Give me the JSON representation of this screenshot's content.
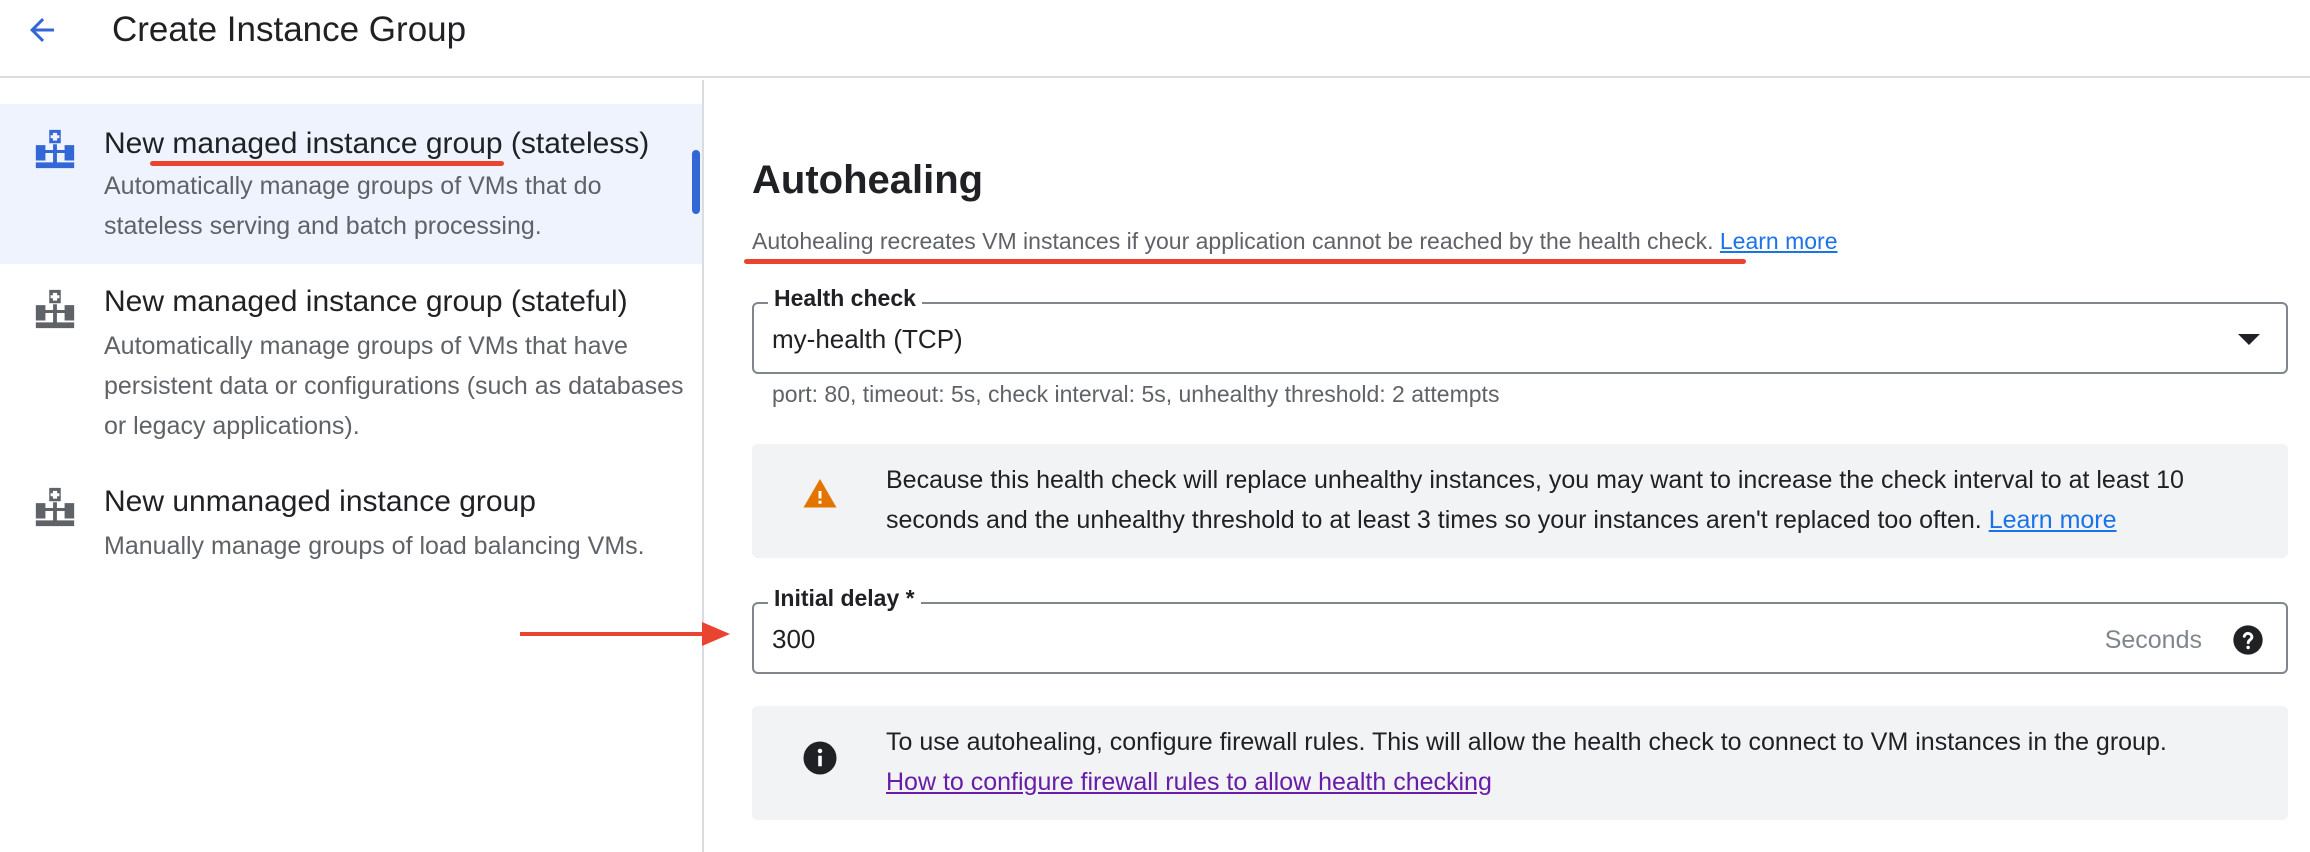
{
  "header": {
    "title": "Create Instance Group",
    "back_icon": "arrow-back-icon"
  },
  "sidebar": {
    "options": [
      {
        "title": "New managed instance group (stateless)",
        "description": "Automatically manage groups of VMs that do stateless serving and batch processing.",
        "icon": "instance-group-icon",
        "selected": true
      },
      {
        "title": "New managed instance group (stateful)",
        "description": "Automatically manage groups of VMs that have persistent data or configurations (such as databases or legacy applications).",
        "icon": "instance-group-icon",
        "selected": false
      },
      {
        "title": "New unmanaged instance group",
        "description": "Manually manage groups of load balancing VMs.",
        "icon": "instance-group-icon",
        "selected": false
      }
    ]
  },
  "autohealing": {
    "title": "Autohealing",
    "description": "Autohealing recreates VM instances if your application cannot be reached by the health check.",
    "learn_more": "Learn more",
    "health_check": {
      "label": "Health check",
      "value": "my-health (TCP)",
      "hint": "port: 80, timeout: 5s, check interval: 5s, unhealthy threshold: 2 attempts"
    },
    "warning": {
      "icon": "warning-icon",
      "text": "Because this health check will replace unhealthy instances, you may want to increase the check interval to at least 10 seconds and the unhealthy threshold to at least 3 times so your instances aren't replaced too often.",
      "link": "Learn more"
    },
    "initial_delay": {
      "label": "Initial delay *",
      "value": "300",
      "suffix": "Seconds",
      "help_icon": "help-icon"
    },
    "info": {
      "icon": "info-icon",
      "text": "To use autohealing, configure firewall rules. This will allow the health check to connect to VM instances in the group.",
      "link": "How to configure firewall rules to allow health checking"
    }
  },
  "colors": {
    "accent": "#3367d6",
    "link": "#1a73e8",
    "visited_link": "#681da8",
    "warning": "#e37400",
    "annotation": "#ea4330",
    "selected_bg": "#eef3fd",
    "notice_bg": "#f1f3f4"
  }
}
